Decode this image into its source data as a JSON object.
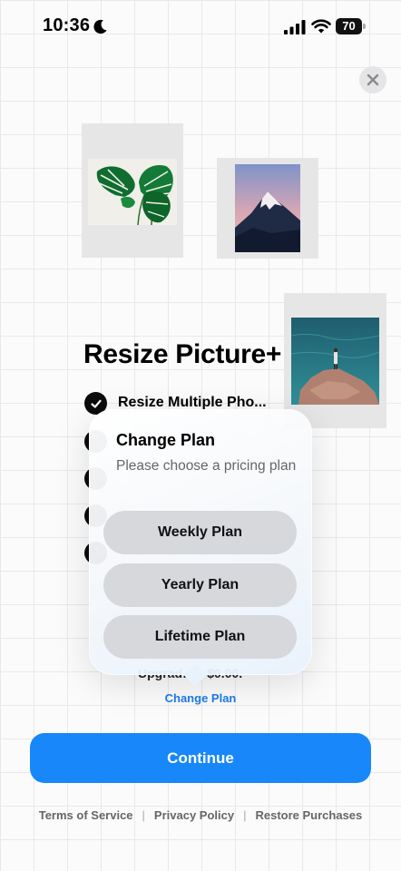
{
  "status_bar": {
    "time": "10:36",
    "battery": "70",
    "icons": [
      "moon-icon",
      "signal-icon",
      "wifi-icon",
      "battery-icon"
    ]
  },
  "close_icon": "close-icon",
  "colors": {
    "accent": "#1787f9",
    "link": "#1d7ce8",
    "plan_button": "#d6d8dc",
    "check": "#0b0b0b"
  },
  "paywall": {
    "title": "Resize Picture+",
    "features": [
      "Resize Multiple Pho..."
    ],
    "upgrade_text": "Upgrad… r $0.00.",
    "change_plan_link": "Change Plan",
    "continue_label": "Continue"
  },
  "popover": {
    "title": "Change Plan",
    "subtitle": "Please choose a pricing plan",
    "plans": [
      "Weekly Plan",
      "Yearly Plan",
      "Lifetime Plan"
    ]
  },
  "footer": {
    "links": [
      "Terms of Service",
      "Privacy Policy",
      "Restore Purchases"
    ],
    "separator": "|"
  }
}
